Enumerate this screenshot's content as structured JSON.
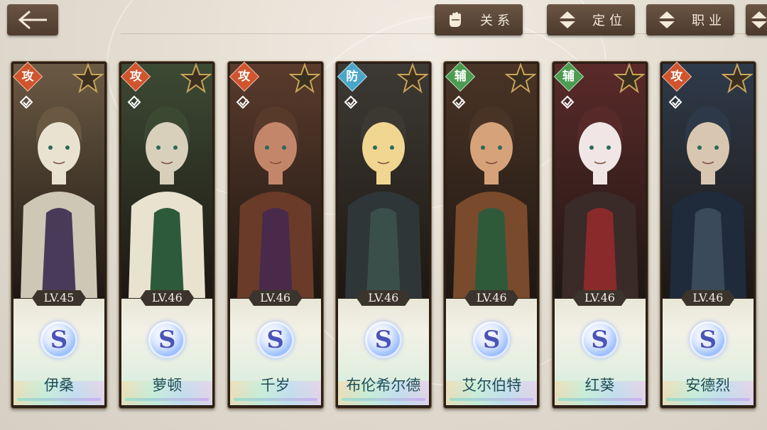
{
  "header": {
    "back_icon": "back-arrow-icon",
    "buttons": [
      {
        "label": "关系",
        "icon": "glove-icon"
      },
      {
        "label": "定位",
        "icon": "sort-icon"
      },
      {
        "label": "职业",
        "icon": "sort-icon"
      }
    ]
  },
  "roles": {
    "attack": {
      "label": "攻",
      "color": "#d0552e"
    },
    "defense": {
      "label": "防",
      "color": "#4aa6c8"
    },
    "support": {
      "label": "辅",
      "color": "#4c9c52"
    }
  },
  "characters": [
    {
      "name": "伊桑",
      "level": "LV.45",
      "role": "攻",
      "rank": "S"
    },
    {
      "name": "萝顿",
      "level": "LV.46",
      "role": "攻",
      "rank": "S"
    },
    {
      "name": "千岁",
      "level": "LV.46",
      "role": "攻",
      "rank": "S"
    },
    {
      "name": "布伦希尔德",
      "level": "LV.46",
      "role": "防",
      "rank": "S"
    },
    {
      "name": "艾尔伯特",
      "level": "LV.46",
      "role": "辅",
      "rank": "S"
    },
    {
      "name": "红葵",
      "level": "LV.46",
      "role": "辅",
      "rank": "S"
    },
    {
      "name": "安德烈",
      "level": "LV.46",
      "role": "攻",
      "rank": "S"
    }
  ]
}
